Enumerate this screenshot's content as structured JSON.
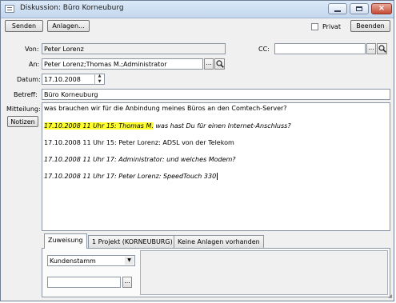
{
  "window": {
    "title": "Diskussion: Büro Korneuburg"
  },
  "toolbar": {
    "send_label": "Senden",
    "attachments_label": "Anlagen...",
    "private_label": "Privat",
    "private_checked": false,
    "exit_label": "Beenden"
  },
  "form": {
    "from_label": "Von:",
    "from_value": "Peter Lorenz",
    "to_label": "An:",
    "to_value": "Peter Lorenz;Thomas M.;Administrator",
    "cc_label": "CC:",
    "cc_value": "",
    "date_label": "Datum:",
    "date_value": "17.10.2008",
    "subject_label": "Betreff:",
    "subject_value": "Büro Korneuburg",
    "message_label": "Mitteilung:",
    "notes_label": "Notizen",
    "browse_label": "...",
    "spin_up": "▲",
    "spin_down": "▼"
  },
  "message": {
    "line1": "was brauchen wir für die Anbindung meines Büros an den Comtech-Server?",
    "line2_highlight": "17.10.2008 11 Uhr 15: Thomas M.",
    "line2_rest": " was hast Du für einen Internet-Anschluss?",
    "line3": "17.10.2008 11 Uhr 15: Peter Lorenz: ADSL von der Telekom",
    "line4": "17.10.2008 11 Uhr 17: Administrator: und welches Modem?",
    "line5": "17.10.2008 11 Uhr 17: Peter Lorenz: SpeedTouch 330"
  },
  "tabs": [
    {
      "label": "Zuweisung",
      "active": true
    },
    {
      "label": "1 Projekt (KORNEUBURG)",
      "active": false
    },
    {
      "label": "Keine Anlagen vorhanden",
      "active": false
    }
  ],
  "assignment": {
    "combo_value": "Kundenstamm",
    "combo_arrow": "▼",
    "lookup_value": "",
    "browse_label": "..."
  },
  "colors": {
    "highlight": "#ffff2e",
    "title_bar": "#c3d7ee"
  }
}
